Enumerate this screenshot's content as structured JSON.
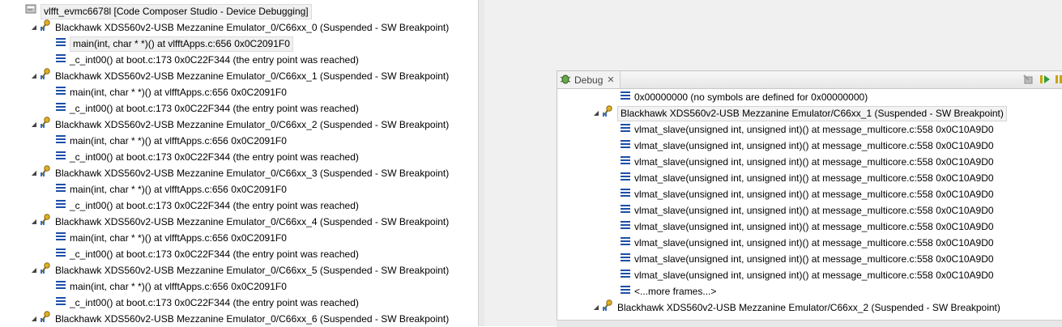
{
  "left_tree": {
    "session_label": "vlfft_evmc6678l [Code Composer Studio - Device Debugging]",
    "threads": [
      {
        "label": "Blackhawk XDS560v2-USB Mezzanine Emulator_0/C66xx_0 (Suspended - SW Breakpoint)",
        "frames": [
          "main(int, char * *)() at vlfftApps.c:656 0x0C2091F0",
          "_c_int00() at boot.c:173 0x0C22F344  (the entry point was reached)"
        ]
      },
      {
        "label": "Blackhawk XDS560v2-USB Mezzanine Emulator_0/C66xx_1 (Suspended - SW Breakpoint)",
        "frames": [
          "main(int, char * *)() at vlfftApps.c:656 0x0C2091F0",
          "_c_int00() at boot.c:173 0x0C22F344  (the entry point was reached)"
        ]
      },
      {
        "label": "Blackhawk XDS560v2-USB Mezzanine Emulator_0/C66xx_2 (Suspended - SW Breakpoint)",
        "frames": [
          "main(int, char * *)() at vlfftApps.c:656 0x0C2091F0",
          "_c_int00() at boot.c:173 0x0C22F344  (the entry point was reached)"
        ]
      },
      {
        "label": "Blackhawk XDS560v2-USB Mezzanine Emulator_0/C66xx_3 (Suspended - SW Breakpoint)",
        "frames": [
          "main(int, char * *)() at vlfftApps.c:656 0x0C2091F0",
          "_c_int00() at boot.c:173 0x0C22F344  (the entry point was reached)"
        ]
      },
      {
        "label": "Blackhawk XDS560v2-USB Mezzanine Emulator_0/C66xx_4 (Suspended - SW Breakpoint)",
        "frames": [
          "main(int, char * *)() at vlfftApps.c:656 0x0C2091F0",
          "_c_int00() at boot.c:173 0x0C22F344  (the entry point was reached)"
        ]
      },
      {
        "label": "Blackhawk XDS560v2-USB Mezzanine Emulator_0/C66xx_5 (Suspended - SW Breakpoint)",
        "frames": [
          "main(int, char * *)() at vlfftApps.c:656 0x0C2091F0",
          "_c_int00() at boot.c:173 0x0C22F344  (the entry point was reached)"
        ]
      },
      {
        "label": "Blackhawk XDS560v2-USB Mezzanine Emulator_0/C66xx_6 (Suspended - SW Breakpoint)",
        "frames": []
      }
    ]
  },
  "debug_view": {
    "tab_label": "Debug",
    "tab_close": "✕",
    "rows": [
      {
        "kind": "frame",
        "text": "0x00000000  (no symbols are defined for 0x00000000)"
      },
      {
        "kind": "thread",
        "text": "Blackhawk XDS560v2-USB Mezzanine Emulator/C66xx_1 (Suspended - SW Breakpoint)",
        "selected": true
      },
      {
        "kind": "frame",
        "text": "vlmat_slave(unsigned int, unsigned int)() at message_multicore.c:558 0x0C10A9D0"
      },
      {
        "kind": "frame",
        "text": "vlmat_slave(unsigned int, unsigned int)() at message_multicore.c:558 0x0C10A9D0"
      },
      {
        "kind": "frame",
        "text": "vlmat_slave(unsigned int, unsigned int)() at message_multicore.c:558 0x0C10A9D0"
      },
      {
        "kind": "frame",
        "text": "vlmat_slave(unsigned int, unsigned int)() at message_multicore.c:558 0x0C10A9D0"
      },
      {
        "kind": "frame",
        "text": "vlmat_slave(unsigned int, unsigned int)() at message_multicore.c:558 0x0C10A9D0"
      },
      {
        "kind": "frame",
        "text": "vlmat_slave(unsigned int, unsigned int)() at message_multicore.c:558 0x0C10A9D0"
      },
      {
        "kind": "frame",
        "text": "vlmat_slave(unsigned int, unsigned int)() at message_multicore.c:558 0x0C10A9D0"
      },
      {
        "kind": "frame",
        "text": "vlmat_slave(unsigned int, unsigned int)() at message_multicore.c:558 0x0C10A9D0"
      },
      {
        "kind": "frame",
        "text": "vlmat_slave(unsigned int, unsigned int)() at message_multicore.c:558 0x0C10A9D0"
      },
      {
        "kind": "frame",
        "text": "vlmat_slave(unsigned int, unsigned int)() at message_multicore.c:558 0x0C10A9D0"
      },
      {
        "kind": "frame",
        "text": "<...more frames...>"
      },
      {
        "kind": "thread",
        "text": "Blackhawk XDS560v2-USB Mezzanine Emulator/C66xx_2 (Suspended - SW Breakpoint)",
        "selected": false
      }
    ]
  },
  "icons": {
    "session": "debug-session-icon",
    "thread": "suspended-thread-icon",
    "frame": "stack-frame-icon",
    "tab": "debug-bug-icon",
    "toolbar": [
      "remove-terminated-icon",
      "resume-icon",
      "suspend-icon"
    ]
  },
  "colors": {
    "frame_icon": "#1c4fa8",
    "thread_icon": "#d9a100",
    "resume": "#2f9e35",
    "suspend": "#c9a400"
  }
}
